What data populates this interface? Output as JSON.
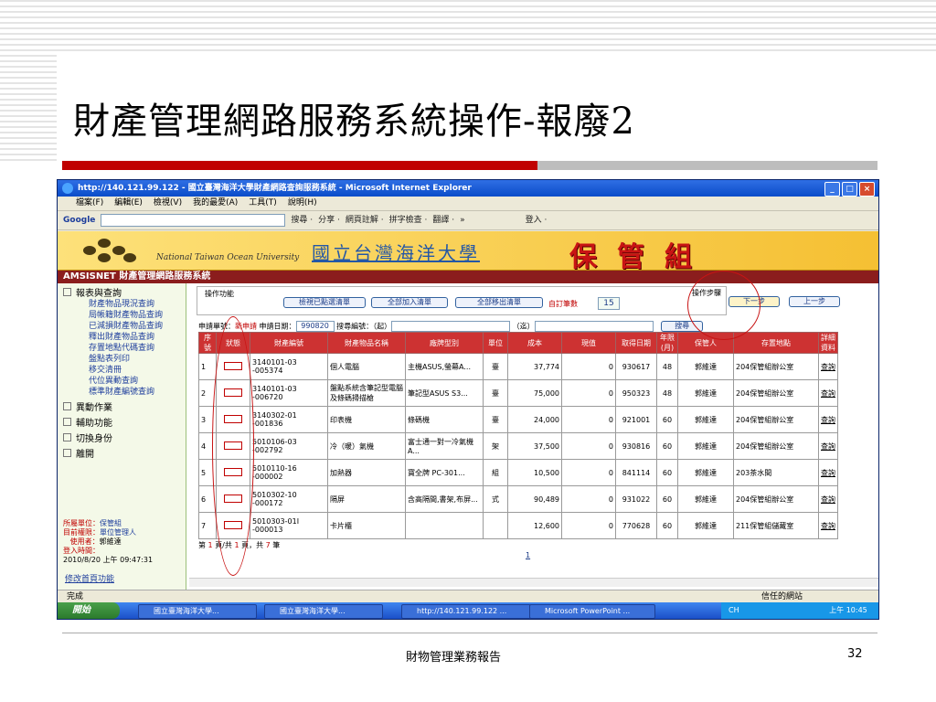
{
  "slide": {
    "title": "財產管理網路服務系統操作-報廢2",
    "footer_text": "財物管理業務報告",
    "page_number": "32"
  },
  "browser": {
    "window_title": "http://140.121.99.122 - 國立臺灣海洋大學財產網路查詢服務系統 - Microsoft Internet Explorer",
    "menu": [
      "檔案(F)",
      "編輯(E)",
      "檢視(V)",
      "我的最愛(A)",
      "工具(T)",
      "說明(H)"
    ],
    "google_label": "Google",
    "toolbar": [
      "搜尋 ·",
      "分享 ·",
      "網頁註解 ·",
      "拼字檢查 ·",
      "翻譯 ·",
      "»",
      "登入 ·"
    ],
    "status": "完成",
    "trusted_zone": "信任的網站"
  },
  "banner": {
    "english": "National Taiwan Ocean University",
    "university": "國立台灣海洋大學",
    "department": "保管組",
    "system_title": "AMSISNET 財產管理網路服務系統"
  },
  "sidebar": {
    "groups": [
      {
        "label": "報表與查詢",
        "items": [
          "財產物品現況查詢",
          "局帳籍財產物品查詢",
          "已減損財產物品查詢",
          "釋出財產物品查詢",
          "存置地點代碼查詢",
          "盤點表列印",
          "移交清冊",
          "代位異動查詢",
          "標準財產編號查詢"
        ]
      },
      {
        "label": "異動作業",
        "items": []
      },
      {
        "label": "輔助功能",
        "items": []
      },
      {
        "label": "切換身份",
        "items": []
      },
      {
        "label": "離開",
        "items": []
      }
    ],
    "info": {
      "unit_label": "所屬單位：",
      "unit": "保管組",
      "role_label": "目前權限：",
      "role": "單位管理人",
      "user_label": "使用者：",
      "user": "郭維達",
      "login_label": "登入時間：",
      "login_time": "2010/8/20 上午 09:47:31"
    },
    "change_password": "修改首頁功能"
  },
  "ops": {
    "label": "操作功能",
    "buttons": [
      "檢視已點選清單",
      "全部加入清單",
      "全部移出清單"
    ],
    "count_label": "自訂筆數",
    "count_value": "15",
    "steps_label": "操作步驟",
    "next": "下一步",
    "prev": "上一步"
  },
  "search": {
    "no_label": "申請單號：",
    "no_value": "新申請",
    "date_label": "申請日期：",
    "date_value": "990820",
    "range_label": "搜尋編號：（起）",
    "range_end": "（迄）",
    "search_button": "搜尋"
  },
  "table": {
    "headers": [
      "序號",
      "狀態",
      "財產編號",
      "財產物品名稱",
      "廠牌型別",
      "單位",
      "成本",
      "現值",
      "取得日期",
      "年限(月)",
      "保管人",
      "存置地點",
      "詳細資料"
    ],
    "rows": [
      {
        "seq": "1",
        "code": "3140101-03 -005374",
        "name": "個人電腦",
        "brand": "主機ASUS,螢幕A...",
        "unit": "臺",
        "cost": "37,774",
        "value": "0",
        "date": "930617",
        "life": "48",
        "keeper": "郭維達",
        "place": "204保管組辦公室",
        "detail": "查詢"
      },
      {
        "seq": "2",
        "code": "3140101-03 -006720",
        "name": "盤點系統含筆記型電腦及條碼掃描槍",
        "brand": "筆記型ASUS S3...",
        "unit": "臺",
        "cost": "75,000",
        "value": "0",
        "date": "950323",
        "life": "48",
        "keeper": "郭維達",
        "place": "204保管組辦公室",
        "detail": "查詢"
      },
      {
        "seq": "3",
        "code": "3140302-01 -001836",
        "name": "印表機",
        "brand": "條碼機",
        "unit": "臺",
        "cost": "24,000",
        "value": "0",
        "date": "921001",
        "life": "60",
        "keeper": "郭維達",
        "place": "204保管組辦公室",
        "detail": "查詢"
      },
      {
        "seq": "4",
        "code": "5010106-03 -002792",
        "name": "冷（暖）氣機",
        "brand": "富士通一對一冷氣機A...",
        "unit": "架",
        "cost": "37,500",
        "value": "0",
        "date": "930816",
        "life": "60",
        "keeper": "郭維達",
        "place": "204保管組辦公室",
        "detail": "查詢"
      },
      {
        "seq": "5",
        "code": "5010110-16 -000002",
        "name": "加熱器",
        "brand": "寶全牌 PC-301...",
        "unit": "組",
        "cost": "10,500",
        "value": "0",
        "date": "841114",
        "life": "60",
        "keeper": "郭維達",
        "place": "203茶水間",
        "detail": "查詢"
      },
      {
        "seq": "6",
        "code": "5010302-10 -000172",
        "name": "隔屏",
        "brand": "含高隔間,書架,布屏...",
        "unit": "式",
        "cost": "90,489",
        "value": "0",
        "date": "931022",
        "life": "60",
        "keeper": "郭維達",
        "place": "204保管組辦公室",
        "detail": "查詢"
      },
      {
        "seq": "7",
        "code": "5010303-01I -000013",
        "name": "卡片櫃",
        "brand": "",
        "unit": "",
        "cost": "12,600",
        "value": "0",
        "date": "770628",
        "life": "60",
        "keeper": "郭維達",
        "place": "211保管組儲藏室",
        "detail": "查詢"
      }
    ],
    "pager_prefix": "第",
    "pager_page": "1",
    "pager_mid": "頁/共",
    "pager_total_pages": "1",
    "pager_mid2": "頁，共",
    "pager_total_rows": "7",
    "pager_suffix": "筆",
    "page_link": "1"
  },
  "taskbar": {
    "start": "開始",
    "tasks": [
      "國立臺灣海洋大學...",
      "國立臺灣海洋大學...",
      "http://140.121.99.122 ...",
      "Microsoft PowerPoint ..."
    ],
    "lang": "CH",
    "clock": "上午 10:45"
  },
  "colors": {
    "accent_red": "#c00000",
    "header_red": "#cd3232",
    "banner_gold": "#f5c033",
    "nav_maroon": "#8b1d1d"
  }
}
